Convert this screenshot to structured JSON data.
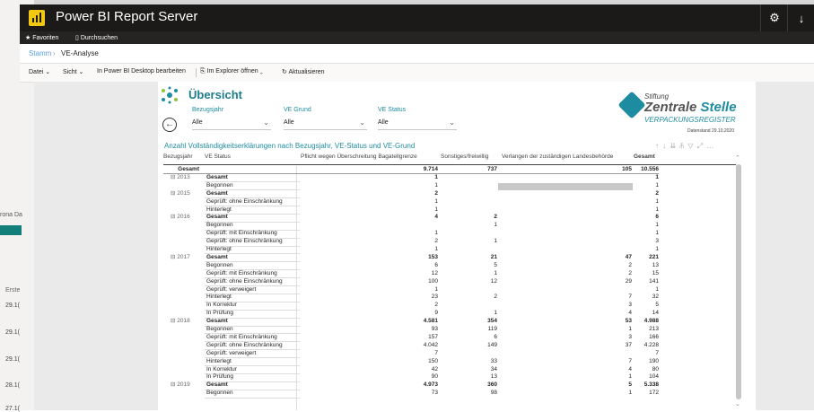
{
  "app": {
    "title": "Power BI Report Server",
    "settings_icon": "gear-icon",
    "download_icon": "download-icon"
  },
  "nav": {
    "favorites": "★ Favoriten",
    "browse": "Durchsuchen"
  },
  "breadcrumb": {
    "home": "Stamm",
    "sep": "›",
    "current": "VE-Analyse"
  },
  "toolbar": {
    "file": "Datei ⌄",
    "view": "Sicht ⌄",
    "edit_desktop": "In Power BI Desktop bearbeiten",
    "open_explorer": "Im Explorer öffnen ⌄",
    "refresh": "Aktualisieren"
  },
  "background_page": {
    "tag": "rona Da",
    "col_label": "Erste",
    "dates": [
      "29.1(",
      "29.1(",
      "29.1(",
      "28.1(",
      "27.1("
    ]
  },
  "report": {
    "title": "Übersicht",
    "slicers": [
      {
        "label": "Bezugsjahr",
        "value": "Alle"
      },
      {
        "label": "VE Grund",
        "value": "Alle"
      },
      {
        "label": "VE Status",
        "value": "Alle"
      }
    ],
    "brand": {
      "line1": "Stiftung",
      "line2a": "Zentrale ",
      "line2b": "Stelle",
      "line3": "VERPACKUNGSREGISTER"
    },
    "data_stamp": "Datenstand 29.10.2020",
    "table_title": "Anzahl Vollständigkeitserklärungen nach Bezugsjahr, VE-Status und VE-Grund",
    "visual_icons": "↑ ↓ ⇊ ⫚ ▽ ⤢ …",
    "columns": [
      "Bezugsjahr",
      "VE Status",
      "Pflicht wegen Überschreitung Bagatellgrenze",
      "Sonstiges/freiwillig",
      "Verlangen der zuständigen Landesbehörde",
      "Gesamt"
    ],
    "rows": [
      {
        "year": "",
        "status": "Gesamt",
        "a": "9.714",
        "b": "737",
        "c": "105",
        "t": "10.556",
        "bold": true,
        "grand": true
      },
      {
        "year": "⊟ 2013",
        "status": "Gesamt",
        "a": "1",
        "b": "",
        "c": "",
        "t": "1",
        "bold": true
      },
      {
        "year": "",
        "status": "Begonnen",
        "a": "1",
        "b": "",
        "c": "",
        "t": "1"
      },
      {
        "year": "⊟ 2015",
        "status": "Gesamt",
        "a": "2",
        "b": "",
        "c": "",
        "t": "2",
        "bold": true
      },
      {
        "year": "",
        "status": "Geprüft: ohne Einschränkung",
        "a": "1",
        "b": "",
        "c": "",
        "t": "1"
      },
      {
        "year": "",
        "status": "Hinterlegt",
        "a": "1",
        "b": "",
        "c": "",
        "t": "1"
      },
      {
        "year": "⊟ 2016",
        "status": "Gesamt",
        "a": "4",
        "b": "2",
        "c": "",
        "t": "6",
        "bold": true
      },
      {
        "year": "",
        "status": "Begonnen",
        "a": "",
        "b": "1",
        "c": "",
        "t": "1"
      },
      {
        "year": "",
        "status": "Geprüft: mit Einschränkung",
        "a": "1",
        "b": "",
        "c": "",
        "t": "1"
      },
      {
        "year": "",
        "status": "Geprüft: ohne Einschränkung",
        "a": "2",
        "b": "1",
        "c": "",
        "t": "3"
      },
      {
        "year": "",
        "status": "Hinterlegt",
        "a": "1",
        "b": "",
        "c": "",
        "t": "1"
      },
      {
        "year": "⊟ 2017",
        "status": "Gesamt",
        "a": "153",
        "b": "21",
        "c": "47",
        "t": "221",
        "bold": true
      },
      {
        "year": "",
        "status": "Begonnen",
        "a": "6",
        "b": "5",
        "c": "2",
        "t": "13"
      },
      {
        "year": "",
        "status": "Geprüft: mit Einschränkung",
        "a": "12",
        "b": "1",
        "c": "2",
        "t": "15"
      },
      {
        "year": "",
        "status": "Geprüft: ohne Einschränkung",
        "a": "100",
        "b": "12",
        "c": "29",
        "t": "141"
      },
      {
        "year": "",
        "status": "Geprüft: verweigert",
        "a": "1",
        "b": "",
        "c": "",
        "t": "1"
      },
      {
        "year": "",
        "status": "Hinterlegt",
        "a": "23",
        "b": "2",
        "c": "7",
        "t": "32"
      },
      {
        "year": "",
        "status": "In Korrektur",
        "a": "2",
        "b": "",
        "c": "3",
        "t": "5"
      },
      {
        "year": "",
        "status": "In Prüfung",
        "a": "9",
        "b": "1",
        "c": "4",
        "t": "14"
      },
      {
        "year": "⊟ 2018",
        "status": "Gesamt",
        "a": "4.581",
        "b": "354",
        "c": "53",
        "t": "4.988",
        "bold": true
      },
      {
        "year": "",
        "status": "Begonnen",
        "a": "93",
        "b": "119",
        "c": "1",
        "t": "213"
      },
      {
        "year": "",
        "status": "Geprüft: mit Einschränkung",
        "a": "157",
        "b": "6",
        "c": "3",
        "t": "166"
      },
      {
        "year": "",
        "status": "Geprüft: ohne Einschränkung",
        "a": "4.042",
        "b": "149",
        "c": "37",
        "t": "4.228"
      },
      {
        "year": "",
        "status": "Geprüft: verweigert",
        "a": "7",
        "b": "",
        "c": "",
        "t": "7"
      },
      {
        "year": "",
        "status": "Hinterlegt",
        "a": "150",
        "b": "33",
        "c": "7",
        "t": "190"
      },
      {
        "year": "",
        "status": "In Korrektur",
        "a": "42",
        "b": "34",
        "c": "4",
        "t": "80"
      },
      {
        "year": "",
        "status": "In Prüfung",
        "a": "90",
        "b": "13",
        "c": "1",
        "t": "104"
      },
      {
        "year": "⊟ 2019",
        "status": "Gesamt",
        "a": "4.973",
        "b": "360",
        "c": "5",
        "t": "5.338",
        "bold": true
      },
      {
        "year": "",
        "status": "Begonnen",
        "a": "73",
        "b": "98",
        "c": "1",
        "t": "172"
      }
    ]
  }
}
